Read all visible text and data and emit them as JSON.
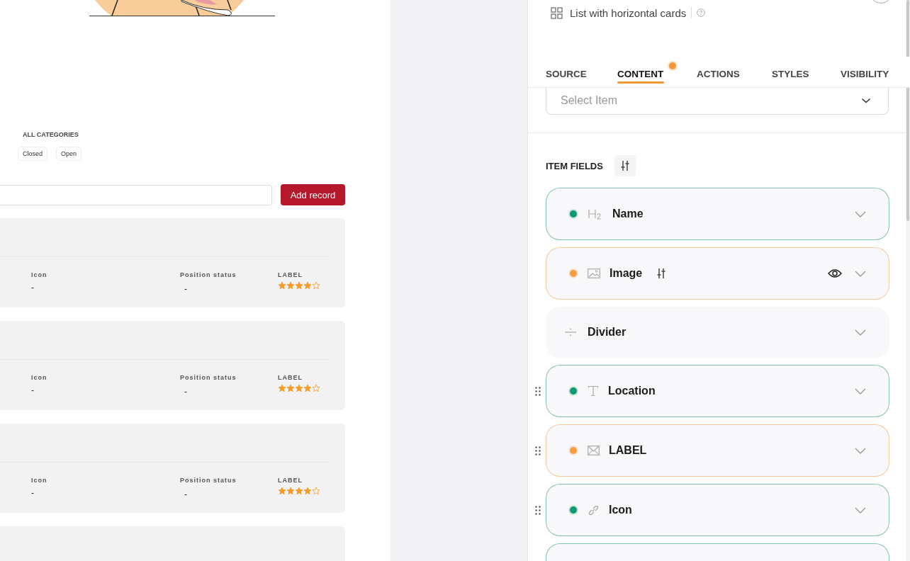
{
  "categories": {
    "title": "ALL CATEGORIES",
    "chips": [
      "Closed",
      "Open"
    ]
  },
  "add_button": "Add record",
  "records": [
    {
      "fields": [
        {
          "label": "Icon",
          "value": "-"
        },
        {
          "label": "Position status",
          "value": "-"
        }
      ],
      "rating": {
        "label": "LABEL",
        "stars": 4
      }
    },
    {
      "fields": [
        {
          "label": "Icon",
          "value": "-"
        },
        {
          "label": "Position status",
          "value": "-"
        }
      ],
      "rating": {
        "label": "LABEL",
        "stars": 4
      }
    },
    {
      "fields": [
        {
          "label": "Icon",
          "value": "-"
        },
        {
          "label": "Position status",
          "value": "-"
        }
      ],
      "rating": {
        "label": "LABEL",
        "stars": 4
      }
    }
  ],
  "panel": {
    "component": "List with horizontal cards",
    "tabs": [
      {
        "label": "SOURCE",
        "selected": false,
        "changed": false
      },
      {
        "label": "CONTENT",
        "selected": true,
        "changed": true
      },
      {
        "label": "ACTIONS",
        "selected": false,
        "changed": false
      },
      {
        "label": "STYLES",
        "selected": false,
        "changed": false
      },
      {
        "label": "VISIBILITY",
        "selected": false,
        "changed": false
      }
    ],
    "select": {
      "placeholder": "Select Item"
    },
    "item_fields_title": "ITEM FIELDS",
    "fields": [
      {
        "label": "Name",
        "kind": "heading",
        "color": "#0e9874",
        "drag_handle": false,
        "settings": false,
        "visibility": false
      },
      {
        "label": "Image",
        "kind": "image",
        "color": "#f59e42",
        "drag_handle": false,
        "settings": true,
        "visibility": true
      },
      {
        "label": "Divider",
        "kind": "divider",
        "drag_handle": false,
        "settings": false,
        "visibility": false
      },
      {
        "label": "Location",
        "kind": "text",
        "color": "#0e9874",
        "drag_handle": true,
        "settings": false,
        "visibility": false
      },
      {
        "label": "LABEL",
        "kind": "mail",
        "color": "#f59e42",
        "drag_handle": true,
        "settings": false,
        "visibility": false
      },
      {
        "label": "Icon",
        "kind": "link",
        "color": "#0e9874",
        "drag_handle": true,
        "settings": false,
        "visibility": false
      }
    ]
  }
}
